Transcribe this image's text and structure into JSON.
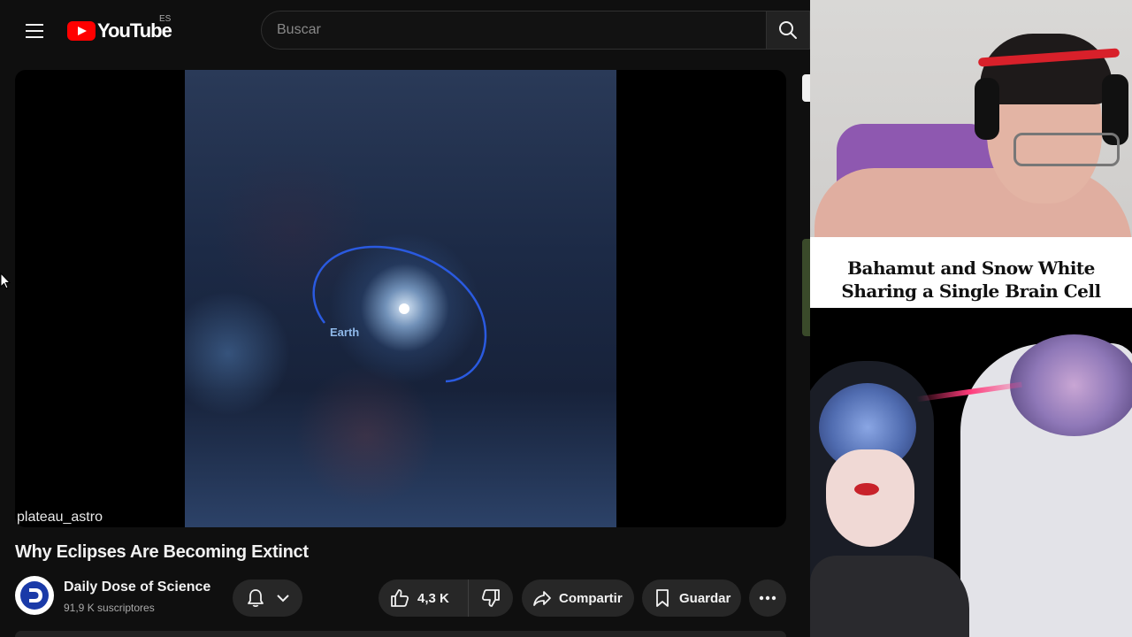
{
  "header": {
    "logo_text": "YouTube",
    "logo_country": "ES",
    "search_placeholder": "Buscar"
  },
  "player": {
    "overlay_label": "Earth",
    "watermark": "plateau_astro"
  },
  "video": {
    "title": "Why Eclipses Are Becoming Extinct",
    "channel_name": "Daily Dose of Science",
    "subscribers": "91,9 K suscriptores",
    "like_count": "4,3 K",
    "share_label": "Compartir",
    "save_label": "Guardar"
  },
  "promo": {
    "title_line1": "Bahamut and Snow White",
    "title_line2": "Sharing a Single Brain Cell"
  },
  "colors": {
    "background": "#0f0f0f",
    "pill": "#272727",
    "brand_red": "#ff0000",
    "orbit": "#2a5ae0",
    "text": "#f1f1f1",
    "muted": "#aaaaaa"
  },
  "icons": [
    "menu-icon",
    "youtube-logo-icon",
    "search-icon",
    "bell-icon",
    "chevron-down-icon",
    "like-icon",
    "dislike-icon",
    "share-icon",
    "save-icon",
    "more-icon",
    "mouse-cursor-icon"
  ]
}
